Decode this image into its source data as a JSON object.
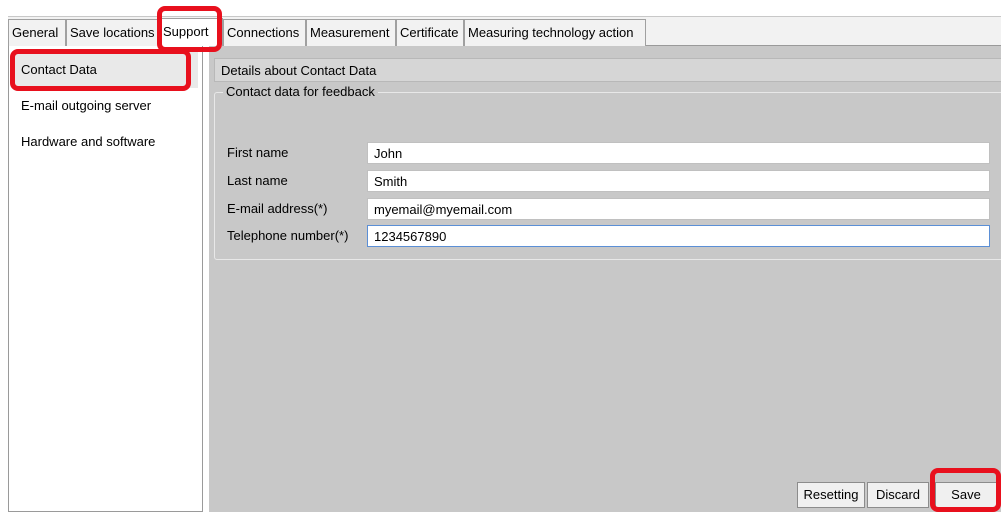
{
  "tabs": [
    {
      "label": "General",
      "active": false
    },
    {
      "label": "Save locations",
      "active": false
    },
    {
      "label": "Support",
      "active": true
    },
    {
      "label": "Connections",
      "active": false
    },
    {
      "label": "Measurement",
      "active": false
    },
    {
      "label": "Certificate",
      "active": false
    },
    {
      "label": "Measuring technology action",
      "active": false
    }
  ],
  "sidebar": {
    "items": [
      {
        "label": "Contact Data",
        "selected": true
      },
      {
        "label": "E-mail outgoing server",
        "selected": false
      },
      {
        "label": "Hardware and software",
        "selected": false
      }
    ]
  },
  "main": {
    "header": "Details about Contact Data",
    "group_title": "Contact data for feedback",
    "fields": [
      {
        "label": "First name",
        "value": "John"
      },
      {
        "label": "Last name",
        "value": "Smith"
      },
      {
        "label": "E-mail address(*)",
        "value": "myemail@myemail.com"
      },
      {
        "label": "Telephone number(*)",
        "value": "1234567890"
      }
    ]
  },
  "buttons": {
    "resetting": "Resetting",
    "discard": "Discard",
    "save": "Save"
  },
  "colors": {
    "highlight": "#e8101d",
    "content_background": "#c8c8c8",
    "focus_border": "#5b8fd6"
  }
}
